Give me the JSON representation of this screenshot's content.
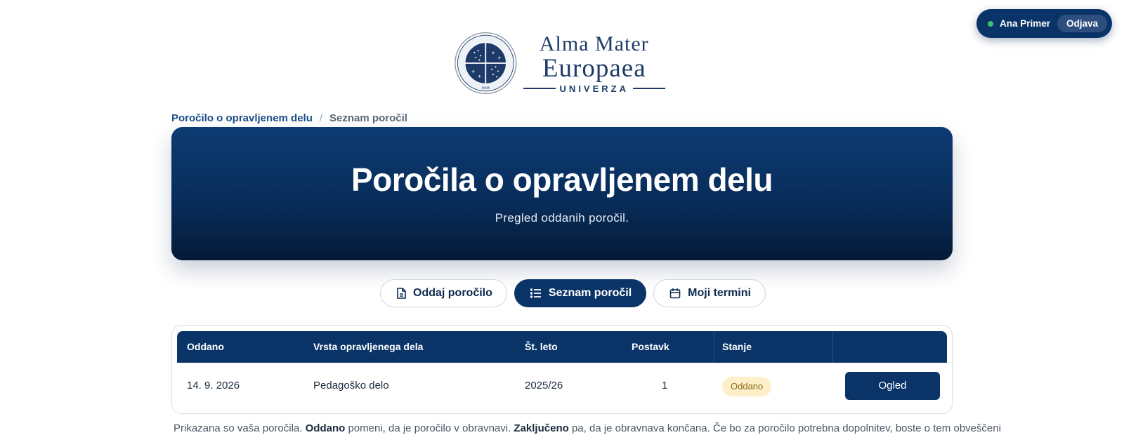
{
  "user": {
    "name": "Ana Primer",
    "logout_label": "Odjava",
    "status_color": "#36c46b"
  },
  "logo": {
    "line1": "Alma Mater",
    "line2": "Europaea",
    "line3": "UNIVERZA",
    "seal_top_text": "ACADEMIA SCIENTIARUM ET ARTIUM EUROPAEA",
    "seal_year": "MXM"
  },
  "breadcrumb": {
    "parent": "Poročilo o opravljenem delu",
    "separator": "/",
    "current": "Seznam poročil"
  },
  "hero": {
    "title": "Poročila o opravljenem delu",
    "subtitle": "Pregled oddanih poročil."
  },
  "tabs": [
    {
      "label": "Oddaj poročilo",
      "icon": "document-icon",
      "active": false
    },
    {
      "label": "Seznam poročil",
      "icon": "list-icon",
      "active": true
    },
    {
      "label": "Moji termini",
      "icon": "calendar-icon",
      "active": false
    }
  ],
  "table": {
    "columns": [
      "Oddano",
      "Vrsta opravljenega dela",
      "Št. leto",
      "Postavk",
      "Stanje",
      ""
    ],
    "rows": [
      {
        "submitted": "14. 9. 2026",
        "type": "Pedagoško delo",
        "year": "2025/26",
        "items": "1",
        "status": "Oddano",
        "action": "Ogled"
      }
    ]
  },
  "note": {
    "part1": "Prikazana so vaša poročila.",
    "bold1": "Oddano",
    "part2": "pomeni, da je poročilo v obravnavi.",
    "bold2": "Zaključeno",
    "part3": "pa, da je obravnava končana. Če bo za poročilo potrebna dopolnitev, boste o tem obveščeni"
  },
  "colors": {
    "primary": "#0a3468",
    "badge_bg": "#fdf0c8",
    "badge_text": "#8a6716"
  }
}
